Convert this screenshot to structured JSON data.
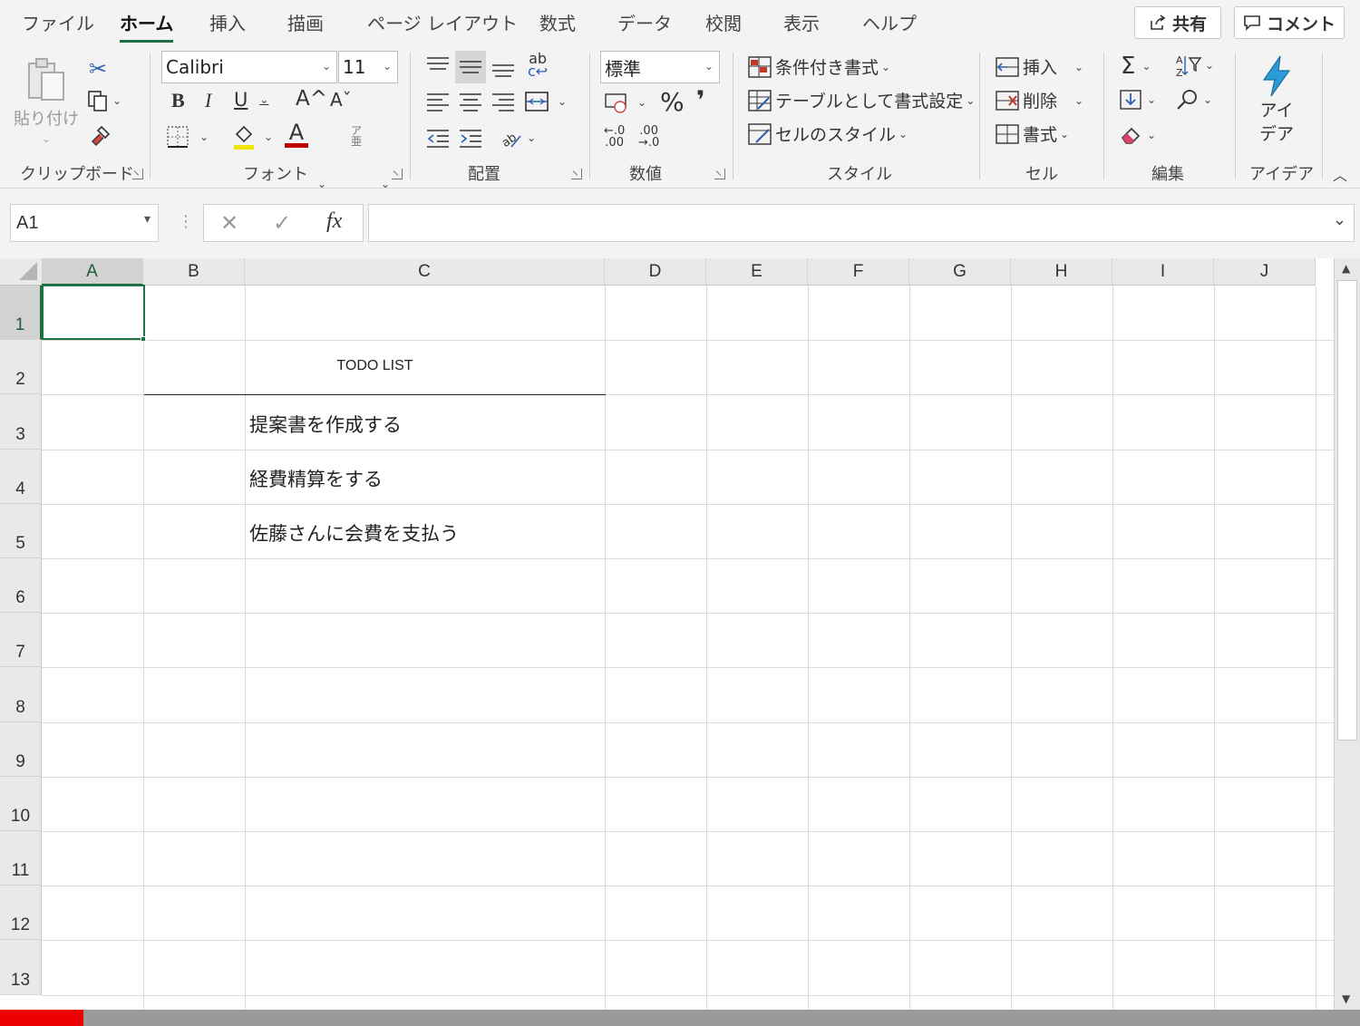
{
  "tabs": [
    {
      "label": "ファイル",
      "active": false
    },
    {
      "label": "ホーム",
      "active": true
    },
    {
      "label": "挿入",
      "active": false
    },
    {
      "label": "描画",
      "active": false
    },
    {
      "label": "ページ レイアウト",
      "active": false
    },
    {
      "label": "数式",
      "active": false
    },
    {
      "label": "データ",
      "active": false
    },
    {
      "label": "校閲",
      "active": false
    },
    {
      "label": "表示",
      "active": false
    },
    {
      "label": "ヘルプ",
      "active": false
    }
  ],
  "share_label": "共有",
  "comment_label": "コメント",
  "ribbon": {
    "clipboard": {
      "paste_label": "貼り付け",
      "group_label": "クリップボード"
    },
    "font": {
      "font_name": "Calibri",
      "font_size": "11",
      "group_label": "フォント",
      "bold": "B",
      "italic": "I",
      "underline": "U",
      "grow": "A^",
      "shrink": "Aˇ",
      "color_letter": "A"
    },
    "alignment": {
      "group_label": "配置"
    },
    "number": {
      "format": "標準",
      "group_label": "数値",
      "percent": "%",
      "comma": "❜"
    },
    "styles": {
      "conditional": "条件付き書式",
      "table": "テーブルとして書式設定",
      "cell_styles": "セルのスタイル",
      "group_label": "スタイル"
    },
    "cells": {
      "insert": "挿入",
      "delete": "削除",
      "format": "書式",
      "group_label": "セル"
    },
    "editing": {
      "group_label": "編集"
    },
    "ideas": {
      "label_line1": "アイ",
      "label_line2": "デア",
      "group_label": "アイデア"
    }
  },
  "formula_bar": {
    "name_box": "A1",
    "fx": "fx",
    "formula": ""
  },
  "sheet": {
    "columns": [
      "A",
      "B",
      "C",
      "D",
      "E",
      "F",
      "G",
      "H",
      "I",
      "J"
    ],
    "rows": [
      "1",
      "2",
      "3",
      "4",
      "5",
      "6",
      "7",
      "8",
      "9",
      "10",
      "11",
      "12",
      "13"
    ],
    "selected_cell": "A1",
    "title": "TODO LIST",
    "items": [
      "提案書を作成する",
      "経費精算をする",
      "佐藤さんに会費を支払う"
    ]
  },
  "colors": {
    "accent": "#1e6e43",
    "selection": "#217346"
  }
}
